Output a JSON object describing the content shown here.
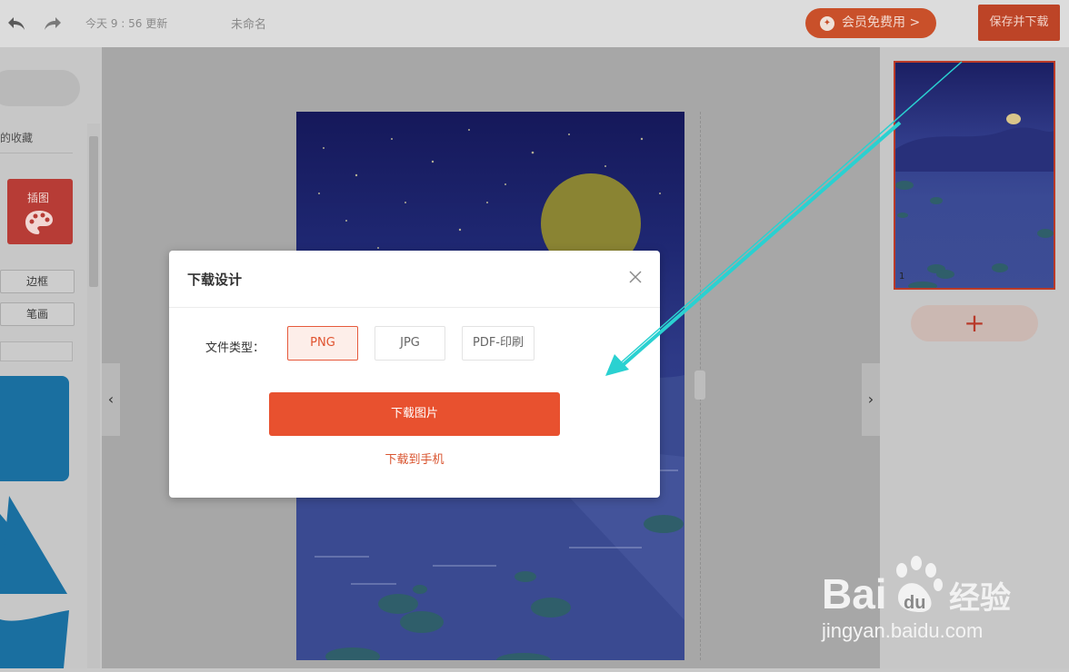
{
  "topbar": {
    "undo_icon": "undo-arrow-icon",
    "redo_icon": "redo-arrow-icon",
    "saved_time": "今天 9 : 56 更新",
    "doc_name": "未命名",
    "vip_label": "会员免费用 >",
    "save_label": "保存并下载"
  },
  "sidebar": {
    "favorites_label": "的收藏",
    "illustration_label": "插图",
    "chips": [
      "边框",
      "笔画"
    ]
  },
  "right_panel": {
    "page_number": "1",
    "add_page_label": "+"
  },
  "modal": {
    "title": "下载设计",
    "file_type_label": "文件类型：",
    "file_types": [
      "PNG",
      "JPG",
      "PDF-印刷"
    ],
    "selected_file_type": "PNG",
    "download_button": "下载图片",
    "download_phone": "下载到手机"
  },
  "nav": {
    "collapse_left": "‹",
    "collapse_right": "›"
  },
  "colors": {
    "accent": "#e8512f",
    "annotation_arrow": "#2ad1d1"
  },
  "watermark": {
    "logo_text": "Bai经验",
    "url": "jingyan.baidu.com"
  }
}
